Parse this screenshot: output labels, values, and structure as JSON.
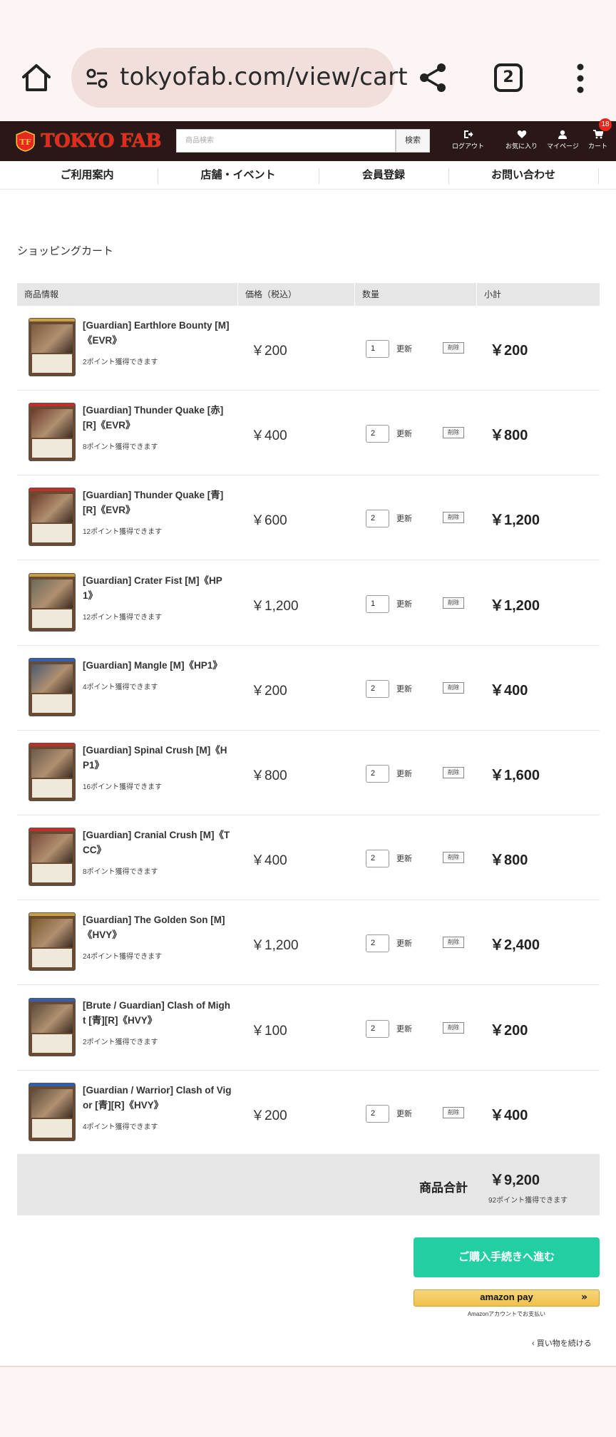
{
  "browser": {
    "url": "tokyofab.com/view/cart",
    "tab_count": "2"
  },
  "header": {
    "logo_text": "TOKYO FAB",
    "search_placeholder": "商品検索",
    "search_button": "検索",
    "logout": "ログアウト",
    "favorites": "お気に入り",
    "mypage": "マイページ",
    "cart": "カート",
    "cart_count": "18"
  },
  "nav": [
    "ご利用案内",
    "店舗・イベント",
    "会員登録",
    "お問い合わせ"
  ],
  "cart": {
    "title": "ショッピングカート",
    "columns": {
      "product": "商品情報",
      "price": "価格（税込）",
      "quantity": "数量",
      "subtotal": "小計"
    },
    "update_label": "更新",
    "delete_label": "削除",
    "items": [
      {
        "name": "[Guardian] Earthlore Bounty [M]《EVR》",
        "points": "2ポイント獲得できます",
        "price": "￥200",
        "qty": "1",
        "subtotal": "￥200",
        "pitch_color": "#c8a040"
      },
      {
        "name": "[Guardian] Thunder Quake [赤][R]《EVR》",
        "points": "8ポイント獲得できます",
        "price": "￥400",
        "qty": "2",
        "subtotal": "￥800",
        "pitch_color": "#c0302a"
      },
      {
        "name": "[Guardian] Thunder Quake [青][R]《EVR》",
        "points": "12ポイント獲得できます",
        "price": "￥600",
        "qty": "2",
        "subtotal": "￥1,200",
        "pitch_color": "#c0302a"
      },
      {
        "name": "[Guardian] Crater Fist [M]《HP1》",
        "points": "12ポイント獲得できます",
        "price": "￥1,200",
        "qty": "1",
        "subtotal": "￥1,200",
        "pitch_color": "#c8a040"
      },
      {
        "name": "[Guardian] Mangle [M]《HP1》",
        "points": "4ポイント獲得できます",
        "price": "￥200",
        "qty": "2",
        "subtotal": "￥400",
        "pitch_color": "#3060b0"
      },
      {
        "name": "[Guardian] Spinal Crush [M]《HP1》",
        "points": "16ポイント獲得できます",
        "price": "￥800",
        "qty": "2",
        "subtotal": "￥1,600",
        "pitch_color": "#c0302a"
      },
      {
        "name": "[Guardian] Cranial Crush [M]《TCC》",
        "points": "8ポイント獲得できます",
        "price": "￥400",
        "qty": "2",
        "subtotal": "￥800",
        "pitch_color": "#c0302a"
      },
      {
        "name": "[Guardian] The Golden Son [M]《HVY》",
        "points": "24ポイント獲得できます",
        "price": "￥1,200",
        "qty": "2",
        "subtotal": "￥2,400",
        "pitch_color": "#c8a040"
      },
      {
        "name": "[Brute / Guardian] Clash of Might [青][R]《HVY》",
        "points": "2ポイント獲得できます",
        "price": "￥100",
        "qty": "2",
        "subtotal": "￥200",
        "pitch_color": "#3060b0"
      },
      {
        "name": "[Guardian / Warrior] Clash of Vigor [青][R]《HVY》",
        "points": "4ポイント獲得できます",
        "price": "￥200",
        "qty": "2",
        "subtotal": "￥400",
        "pitch_color": "#3060b0"
      }
    ],
    "total_label": "商品合計",
    "total_value": "￥9,200",
    "total_points": "92ポイント獲得できます",
    "checkout_button": "ご購入手続きへ進む",
    "amazon_pay_label": "amazon pay",
    "amazon_pay_note": "Amazonアカウントでお支払い",
    "continue_shopping": "買い物を続ける"
  },
  "colors": {
    "header_bg": "#2a1717",
    "brand_red": "#e8281f",
    "checkout_green": "#22cfa3",
    "amazon_yellow": "#f0c14b"
  }
}
